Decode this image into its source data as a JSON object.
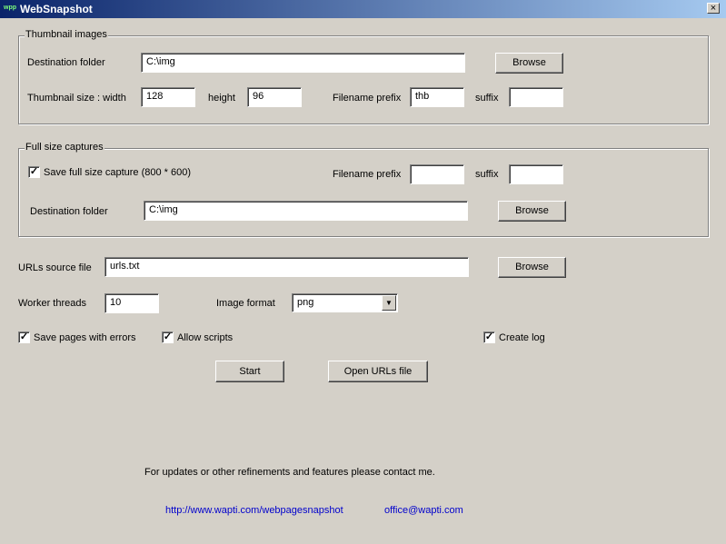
{
  "window": {
    "icon_text": "wpp",
    "title": "WebSnapshot",
    "close_glyph": "×"
  },
  "thumbnail_group": {
    "legend": "Thumbnail images",
    "dest_label": "Destination folder",
    "dest_value": "C:\\img",
    "browse_label": "Browse",
    "size_label": "Thumbnail size : width",
    "width_value": "128",
    "height_label": "height",
    "height_value": "96",
    "prefix_label": "Filename prefix",
    "prefix_value": "thb",
    "suffix_label": "suffix",
    "suffix_value": ""
  },
  "fullsize_group": {
    "legend": "Full size captures",
    "save_label": "Save full size capture (800 * 600)",
    "save_checked": true,
    "prefix_label": "Filename prefix",
    "prefix_value": "",
    "suffix_label": "suffix",
    "suffix_value": "",
    "dest_label": "Destination folder",
    "dest_value": "C:\\img",
    "browse_label": "Browse"
  },
  "urls": {
    "label": "URLs source file",
    "value": "urls.txt",
    "browse_label": "Browse"
  },
  "threads": {
    "label": "Worker threads",
    "value": "10"
  },
  "image_format": {
    "label": "Image format",
    "value": "png"
  },
  "options": {
    "save_errors_label": "Save pages with errors",
    "save_errors_checked": true,
    "allow_scripts_label": "Allow scripts",
    "allow_scripts_checked": true,
    "create_log_label": "Create log",
    "create_log_checked": true
  },
  "actions": {
    "start_label": "Start",
    "open_urls_label": "Open URLs file"
  },
  "footer": {
    "note": "For updates or other refinements and features please contact me.",
    "website": "http://www.wapti.com/webpagesnapshot",
    "email": "office@wapti.com"
  }
}
